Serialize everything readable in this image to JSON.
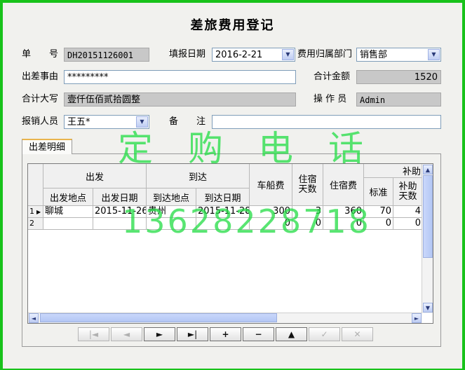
{
  "form": {
    "title": "差旅费用登记",
    "doc_no_label": "单　　号",
    "doc_no": "DH20151126001",
    "fill_date_label": "填报日期",
    "fill_date": "2016-2-21",
    "dept_label": "费用归属部门",
    "dept": "销售部",
    "reason_label": "出差事由",
    "reason": "*********",
    "total_label": "合计金额",
    "total": "1520",
    "total_upper_label": "合计大写",
    "total_upper": "壹仟伍佰贰拾圆整",
    "operator_label": "操 作 员",
    "operator": "Admin",
    "claimant_label": "报销人员",
    "claimant": "王五*",
    "remark_label": "备　　注",
    "remark": ""
  },
  "tab": {
    "label": "出差明细"
  },
  "grid": {
    "group_headers": {
      "depart": "出发",
      "arrive": "到达",
      "fare": "车船费",
      "stay_days": "住宿天数",
      "lodging": "住宿费",
      "allowance": "补助"
    },
    "sub_headers": {
      "depart_place": "出发地点",
      "depart_date": "出发日期",
      "arrive_place": "到达地点",
      "arrive_date": "到达日期",
      "std": "标准",
      "allow_days": "补助天数"
    },
    "rows": [
      {
        "idx": "1",
        "depart_place": "聊城",
        "depart_date": "2015-11-26",
        "arrive_place": "贵州",
        "arrive_date": "2015-11-28",
        "fare": "300",
        "stay_days": "3",
        "lodging": "360",
        "std": "70",
        "allow_days": "4"
      },
      {
        "idx": "2",
        "depart_place": "",
        "depart_date": "",
        "arrive_place": "",
        "arrive_date": "",
        "fare": "0",
        "stay_days": "0",
        "lodging": "0",
        "std": "0",
        "allow_days": "0"
      }
    ]
  },
  "nav": [
    "|◄",
    "◄",
    "►",
    "►|",
    "+",
    "−",
    "▲",
    "✓",
    "✕"
  ],
  "watermark": {
    "line1": "定　购　电　话",
    "line2": "13628228718"
  },
  "icons": {
    "dropdown": "▼",
    "scroll_up": "▲",
    "scroll_down": "▼",
    "scroll_left": "◄",
    "scroll_right": "►",
    "row_pointer": "▶"
  }
}
